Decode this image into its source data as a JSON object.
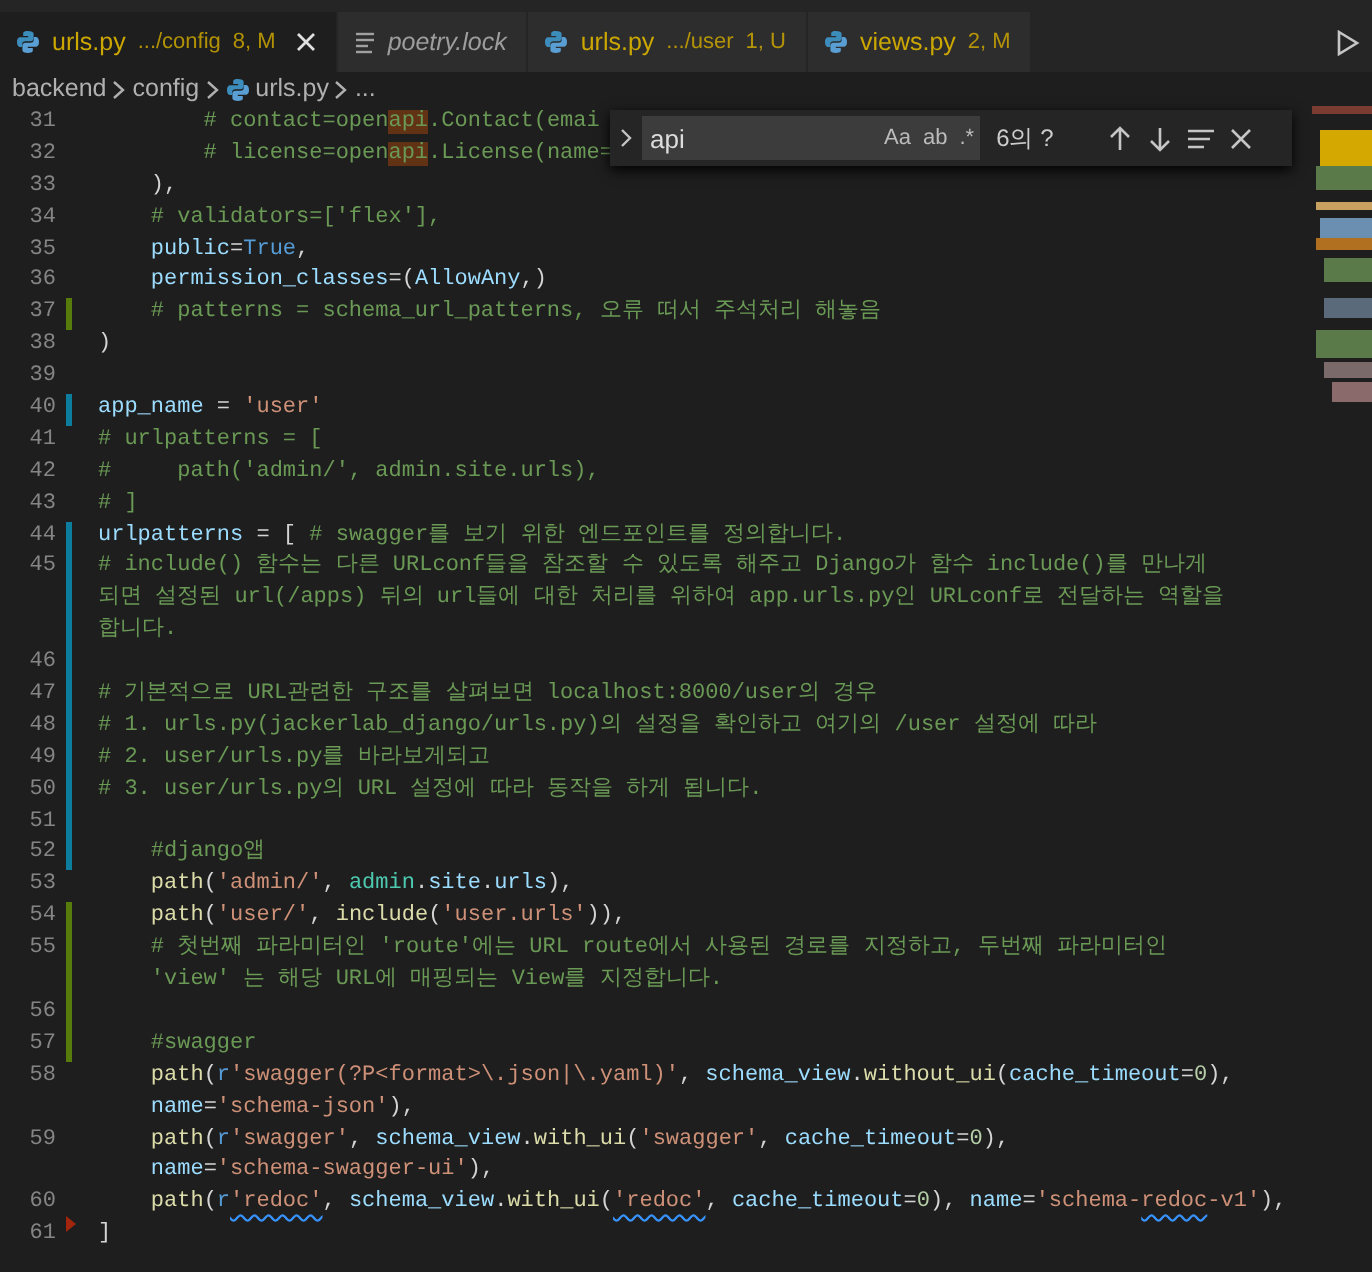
{
  "tabs": [
    {
      "name": "urls.py",
      "path": ".../config",
      "status": "8, M",
      "kind": "python",
      "italic": false,
      "selected": true,
      "color": "#cca700"
    },
    {
      "name": "poetry.lock",
      "kind": "text",
      "italic": true,
      "selected": false,
      "color": "#9d9d9d"
    },
    {
      "name": "urls.py",
      "path": ".../user",
      "status": "1, U",
      "kind": "python",
      "italic": false,
      "selected": false,
      "color": "#cca700"
    },
    {
      "name": "views.py",
      "status": "2, M",
      "kind": "python",
      "italic": false,
      "selected": false,
      "color": "#cca700"
    }
  ],
  "breadcrumb": [
    {
      "text": "backend",
      "kind": "folder"
    },
    {
      "text": "config",
      "kind": "folder"
    },
    {
      "text": "urls.py",
      "kind": "python"
    },
    {
      "text": "...",
      "kind": "folder"
    }
  ],
  "find_widget": {
    "query": "api",
    "options": [
      "Aa",
      "ab",
      ".*"
    ],
    "result_count": "6의 ?"
  },
  "lines": [
    {
      "number": "31",
      "kind": "plain",
      "tokens": [
        {
          "kind": "comment",
          "text": "        # contact=open"
        },
        {
          "kind": "match",
          "text": "api"
        },
        {
          "kind": "comment",
          "text": ".Contact(emai"
        }
      ]
    },
    {
      "number": "32",
      "kind": "plain",
      "tokens": [
        {
          "kind": "comment",
          "text": "        # license=open"
        },
        {
          "kind": "match",
          "text": "api"
        },
        {
          "kind": "comment",
          "text": ".License(name="
        }
      ]
    },
    {
      "number": "33",
      "kind": "plain",
      "tokens": [
        {
          "kind": "punct",
          "text": "    ),"
        }
      ]
    },
    {
      "number": "34",
      "kind": "plain",
      "tokens": [
        {
          "kind": "comment",
          "text": "    # validators=['flex'],"
        }
      ]
    },
    {
      "number": "35",
      "kind": "plain",
      "tokens": [
        {
          "kind": "variable",
          "text": "    public"
        },
        {
          "kind": "punct",
          "text": "="
        },
        {
          "kind": "constant",
          "text": "True"
        },
        {
          "kind": "punct",
          "text": ","
        }
      ]
    },
    {
      "number": "36",
      "kind": "plain",
      "tokens": [
        {
          "kind": "variable",
          "text": "    permission_classes"
        },
        {
          "kind": "punct",
          "text": "=("
        },
        {
          "kind": "variable",
          "text": "AllowAny"
        },
        {
          "kind": "punct",
          "text": ",)"
        }
      ]
    },
    {
      "number": "37",
      "kind": "added",
      "tokens": [
        {
          "kind": "comment",
          "text": "    # patterns = schema_url_patterns, 오류 떠서 주석처리 해놓음"
        }
      ]
    },
    {
      "number": "38",
      "kind": "plain",
      "tokens": [
        {
          "kind": "punct",
          "text": ")"
        }
      ]
    },
    {
      "number": "39",
      "kind": "plain"
    },
    {
      "number": "40",
      "kind": "modified",
      "tokens": [
        {
          "kind": "variable",
          "text": "app_name"
        },
        {
          "kind": "punct",
          "text": " = "
        },
        {
          "kind": "string",
          "text": "'user'"
        }
      ]
    },
    {
      "number": "41",
      "kind": "plain",
      "tokens": [
        {
          "kind": "comment",
          "text": "# urlpatterns = ["
        }
      ]
    },
    {
      "number": "42",
      "kind": "plain",
      "tokens": [
        {
          "kind": "comment",
          "text": "#     path('admin/', admin.site.urls),"
        }
      ]
    },
    {
      "number": "43",
      "kind": "plain",
      "tokens": [
        {
          "kind": "comment",
          "text": "# ]"
        }
      ]
    },
    {
      "number": "44",
      "kind": "modified",
      "tokens": [
        {
          "kind": "variable",
          "text": "urlpatterns"
        },
        {
          "kind": "punct",
          "text": " = [ "
        },
        {
          "kind": "comment",
          "text": "# swagger를 보기 위한 엔드포인트를 정의합니다."
        }
      ]
    },
    {
      "number": "45",
      "kind": "modified",
      "tokens": [
        {
          "kind": "comment",
          "text": "# include() 함수는 다른 URLconf들을 참조할 수 있도록 해주고 Django가 함수 include()를 만나게"
        }
      ]
    },
    {
      "kind": "modified",
      "tokens": [
        {
          "kind": "comment",
          "text": "되면 설정된 url(/apps) 뒤의 url들에 대한 처리를 위하여 app.urls.py인 URLconf로 전달하는 역할을"
        }
      ]
    },
    {
      "kind": "modified",
      "tokens": [
        {
          "kind": "comment",
          "text": "합니다."
        }
      ]
    },
    {
      "number": "46",
      "kind": "modified"
    },
    {
      "number": "47",
      "kind": "modified",
      "tokens": [
        {
          "kind": "comment",
          "text": "# 기본적으로 URL관련한 구조를 살펴보면 localhost:8000/user의 경우"
        }
      ]
    },
    {
      "number": "48",
      "kind": "modified",
      "tokens": [
        {
          "kind": "comment",
          "text": "# 1. urls.py(jackerlab_django/urls.py)의 설정을 확인하고 여기의 /user 설정에 따라"
        }
      ]
    },
    {
      "number": "49",
      "kind": "modified",
      "tokens": [
        {
          "kind": "comment",
          "text": "# 2. user/urls.py를 바라보게되고"
        }
      ]
    },
    {
      "number": "50",
      "kind": "modified",
      "tokens": [
        {
          "kind": "comment",
          "text": "# 3. user/urls.py의 URL 설정에 따라 동작을 하게 됩니다."
        }
      ]
    },
    {
      "number": "51",
      "kind": "modified"
    },
    {
      "number": "52",
      "kind": "modified",
      "tokens": [
        {
          "kind": "comment",
          "text": "    #django앱"
        }
      ]
    },
    {
      "number": "53",
      "kind": "plain",
      "tokens": [
        {
          "kind": "function",
          "text": "    path"
        },
        {
          "kind": "punct",
          "text": "("
        },
        {
          "kind": "string",
          "text": "'admin/'"
        },
        {
          "kind": "punct",
          "text": ", "
        },
        {
          "kind": "class",
          "text": "admin"
        },
        {
          "kind": "punct",
          "text": "."
        },
        {
          "kind": "variable",
          "text": "site"
        },
        {
          "kind": "punct",
          "text": "."
        },
        {
          "kind": "variable",
          "text": "urls"
        },
        {
          "kind": "punct",
          "text": "),"
        }
      ]
    },
    {
      "number": "54",
      "kind": "added",
      "tokens": [
        {
          "kind": "function",
          "text": "    path"
        },
        {
          "kind": "punct",
          "text": "("
        },
        {
          "kind": "string",
          "text": "'user/'"
        },
        {
          "kind": "punct",
          "text": ", "
        },
        {
          "kind": "function",
          "text": "include"
        },
        {
          "kind": "punct",
          "text": "("
        },
        {
          "kind": "string",
          "text": "'user.urls'"
        },
        {
          "kind": "punct",
          "text": ")),"
        }
      ]
    },
    {
      "number": "55",
      "kind": "added",
      "tokens": [
        {
          "kind": "comment",
          "text": "    # 첫번째 파라미터인 'route'에는 URL route에서 사용된 경로를 지정하고, 두번째 파라미터인"
        }
      ]
    },
    {
      "kind": "added",
      "tokens": [
        {
          "kind": "comment",
          "text": "    'view' 는 해당 URL에 매핑되는 View를 지정합니다."
        }
      ]
    },
    {
      "number": "56",
      "kind": "added"
    },
    {
      "number": "57",
      "kind": "added",
      "tokens": [
        {
          "kind": "comment",
          "text": "    #swagger"
        }
      ]
    },
    {
      "number": "58",
      "kind": "plain",
      "tokens": [
        {
          "kind": "function",
          "text": "    path"
        },
        {
          "kind": "punct",
          "text": "("
        },
        {
          "kind": "constant",
          "text": "r"
        },
        {
          "kind": "string",
          "text": "'swagger(?P<format>\\.json|\\.yaml)'"
        },
        {
          "kind": "punct",
          "text": ", "
        },
        {
          "kind": "variable",
          "text": "schema_view"
        },
        {
          "kind": "punct",
          "text": "."
        },
        {
          "kind": "function",
          "text": "without_ui"
        },
        {
          "kind": "punct",
          "text": "("
        },
        {
          "kind": "variable",
          "text": "cache_timeout"
        },
        {
          "kind": "punct",
          "text": "="
        },
        {
          "kind": "number",
          "text": "0"
        },
        {
          "kind": "punct",
          "text": "),"
        }
      ]
    },
    {
      "kind": "plain",
      "tokens": [
        {
          "kind": "variable",
          "text": "    name"
        },
        {
          "kind": "punct",
          "text": "="
        },
        {
          "kind": "string",
          "text": "'schema-json'"
        },
        {
          "kind": "punct",
          "text": "),"
        }
      ]
    },
    {
      "number": "59",
      "kind": "plain",
      "tokens": [
        {
          "kind": "function",
          "text": "    path"
        },
        {
          "kind": "punct",
          "text": "("
        },
        {
          "kind": "constant",
          "text": "r"
        },
        {
          "kind": "string",
          "text": "'swagger'"
        },
        {
          "kind": "punct",
          "text": ", "
        },
        {
          "kind": "variable",
          "text": "schema_view"
        },
        {
          "kind": "punct",
          "text": "."
        },
        {
          "kind": "function",
          "text": "with_ui"
        },
        {
          "kind": "punct",
          "text": "("
        },
        {
          "kind": "string",
          "text": "'swagger'"
        },
        {
          "kind": "punct",
          "text": ", "
        },
        {
          "kind": "variable",
          "text": "cache_timeout"
        },
        {
          "kind": "punct",
          "text": "="
        },
        {
          "kind": "number",
          "text": "0"
        },
        {
          "kind": "punct",
          "text": "),"
        }
      ]
    },
    {
      "kind": "plain",
      "tokens": [
        {
          "kind": "variable",
          "text": "    name"
        },
        {
          "kind": "punct",
          "text": "="
        },
        {
          "kind": "string",
          "text": "'schema-swagger-ui'"
        },
        {
          "kind": "punct",
          "text": "),"
        }
      ]
    },
    {
      "number": "60",
      "kind": "plain",
      "tokens": [
        {
          "kind": "function",
          "text": "    path"
        },
        {
          "kind": "punct",
          "text": "("
        },
        {
          "kind": "constant",
          "text": "r"
        },
        {
          "kind": "string",
          "text": "'redoc'",
          "warning": true
        },
        {
          "kind": "punct",
          "text": ", "
        },
        {
          "kind": "variable",
          "text": "schema_view"
        },
        {
          "kind": "punct",
          "text": "."
        },
        {
          "kind": "function",
          "text": "with_ui"
        },
        {
          "kind": "punct",
          "text": "("
        },
        {
          "kind": "string",
          "text": "'redoc'",
          "warning": true
        },
        {
          "kind": "punct",
          "text": ", "
        },
        {
          "kind": "variable",
          "text": "cache_timeout"
        },
        {
          "kind": "punct",
          "text": "="
        },
        {
          "kind": "number",
          "text": "0"
        },
        {
          "kind": "punct",
          "text": "), "
        },
        {
          "kind": "variable",
          "text": "name"
        },
        {
          "kind": "punct",
          "text": "="
        },
        {
          "kind": "string",
          "text": "'schema-"
        },
        {
          "kind": "string",
          "text": "redoc",
          "warning": true
        },
        {
          "kind": "string",
          "text": "-v1'"
        },
        {
          "kind": "punct",
          "text": "),"
        }
      ]
    },
    {
      "number": "61",
      "kind": "deleted",
      "tokens": [
        {
          "kind": "punct",
          "text": "]"
        }
      ]
    }
  ]
}
